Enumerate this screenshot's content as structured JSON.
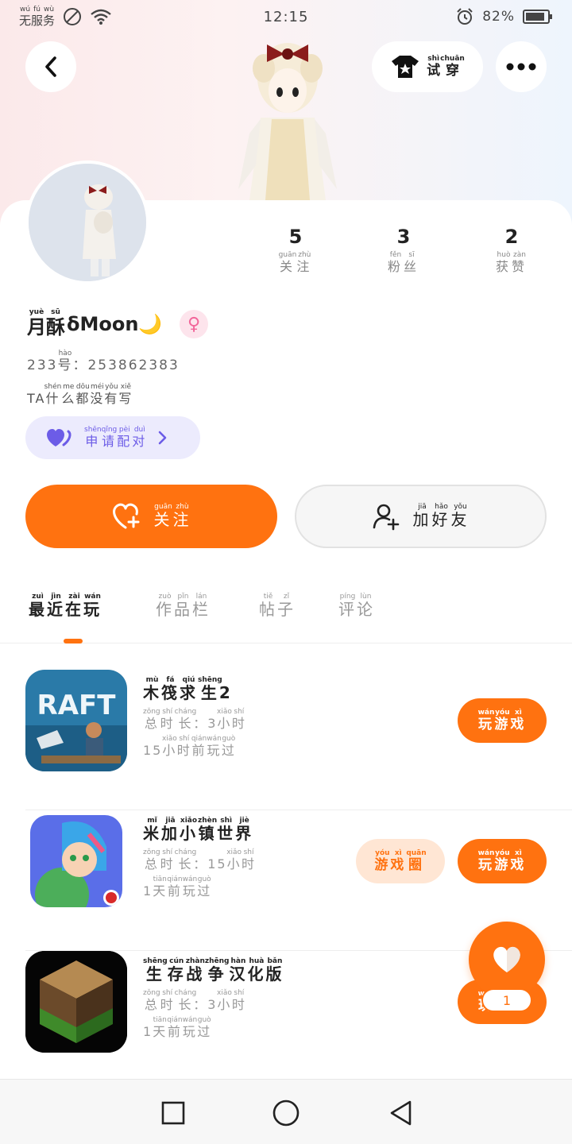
{
  "status_bar": {
    "carrier": "无服务",
    "carrier_pinyin": [
      "wú",
      "fú",
      "wù"
    ],
    "time": "12:15",
    "battery": "82%"
  },
  "header": {
    "back_icon": "chevron-left-icon",
    "tryon_label": "试穿",
    "tryon_pinyin": [
      "shì",
      "chuān"
    ],
    "more_icon": "more-dots-icon"
  },
  "stats": [
    {
      "count": "5",
      "label": [
        "关",
        "注"
      ],
      "pinyin": [
        "guān",
        "zhù"
      ]
    },
    {
      "count": "3",
      "label": [
        "粉",
        "丝"
      ],
      "pinyin": [
        "fěn",
        "sī"
      ]
    },
    {
      "count": "2",
      "label": [
        "获",
        "赞"
      ],
      "pinyin": [
        "huò",
        "zàn"
      ]
    }
  ],
  "profile": {
    "name_chars": [
      "月",
      "酥"
    ],
    "name_pinyin": [
      "yuè",
      "sū"
    ],
    "name_suffix": "δMoon🌙",
    "gender_icon": "female-symbol-icon",
    "id_prefix": "233",
    "id_char": "号",
    "id_char_pinyin": "hào",
    "id_value": "：253862383",
    "sig_prefix": "TA",
    "sig_chars": [
      "什",
      "么",
      "都",
      "没",
      "有",
      "写"
    ],
    "sig_pinyin": [
      "shén",
      "me",
      "dōu",
      "méi",
      "yǒu",
      "xiě"
    ]
  },
  "match": {
    "chars": [
      "申",
      "请",
      "配",
      "对"
    ],
    "pinyin": [
      "shēn",
      "qǐng",
      "pèi",
      "duì"
    ],
    "color": "#6c5ce7"
  },
  "actions": {
    "follow_chars": [
      "关",
      "注"
    ],
    "follow_pinyin": [
      "guān",
      "zhù"
    ],
    "friend_chars": [
      "加",
      "好",
      "友"
    ],
    "friend_pinyin": [
      "jiā",
      "hǎo",
      "yǒu"
    ]
  },
  "tabs": [
    {
      "chars": [
        "最",
        "近",
        "在",
        "玩"
      ],
      "pinyin": [
        "zuì",
        "jìn",
        "zài",
        "wán"
      ],
      "active": true
    },
    {
      "chars": [
        "作",
        "品",
        "栏"
      ],
      "pinyin": [
        "zuò",
        "pǐn",
        "lán"
      ],
      "active": false
    },
    {
      "chars": [
        "帖",
        "子"
      ],
      "pinyin": [
        "tiě",
        "zǐ"
      ],
      "active": false
    },
    {
      "chars": [
        "评",
        "论"
      ],
      "pinyin": [
        "píng",
        "lùn"
      ],
      "active": false
    }
  ],
  "games": [
    {
      "name_chars": [
        "木",
        "筏",
        "求",
        "生"
      ],
      "name_pinyin": [
        "mù",
        "fá",
        "qiú",
        "shēng"
      ],
      "name_suffix": "2",
      "icon_text": "RAFT",
      "time_value": "3",
      "last_value": "15",
      "last_chars": [
        "小",
        "时",
        "前",
        "玩",
        "过"
      ],
      "last_pinyin": [
        "xiǎo",
        "shí",
        "qián",
        "wán",
        "guò"
      ],
      "has_circle": false
    },
    {
      "name_chars": [
        "米",
        "加",
        "小",
        "镇",
        "世",
        "界"
      ],
      "name_pinyin": [
        "mǐ",
        "jiā",
        "xiǎo",
        "zhèn",
        "shì",
        "jiè"
      ],
      "name_suffix": "",
      "icon_text": "",
      "time_value": "15",
      "last_value": "1",
      "last_chars": [
        "天",
        "前",
        "玩",
        "过"
      ],
      "last_pinyin": [
        "tiān",
        "qián",
        "wán",
        "guò"
      ],
      "has_circle": true
    },
    {
      "name_chars": [
        "生",
        "存",
        "战",
        "争",
        "汉",
        "化",
        "版"
      ],
      "name_pinyin": [
        "shēng",
        "cún",
        "zhàn",
        "zhēng",
        "hàn",
        "huà",
        "bǎn"
      ],
      "name_suffix": "",
      "icon_text": "",
      "time_value": "3",
      "last_value": "1",
      "last_chars": [
        "天",
        "前",
        "玩",
        "过"
      ],
      "last_pinyin": [
        "tiān",
        "qián",
        "wán",
        "guò"
      ],
      "has_circle": false
    }
  ],
  "game_common": {
    "time_chars": [
      "总",
      "时",
      "长"
    ],
    "time_pinyin": [
      "zǒng",
      "shí",
      "cháng"
    ],
    "hours_chars": [
      "小",
      "时"
    ],
    "hours_pinyin": [
      "xiǎo",
      "shí"
    ],
    "play_chars": [
      "玩",
      "游",
      "戏"
    ],
    "play_pinyin": [
      "wán",
      "yóu",
      "xì"
    ],
    "circle_chars": [
      "游",
      "戏",
      "圈"
    ],
    "circle_pinyin": [
      "yóu",
      "xì",
      "quān"
    ]
  },
  "floating_like": {
    "count": "1",
    "icon": "heart-icon"
  },
  "colors": {
    "accent": "#ff7210",
    "text": "#222222",
    "muted": "#999999"
  }
}
